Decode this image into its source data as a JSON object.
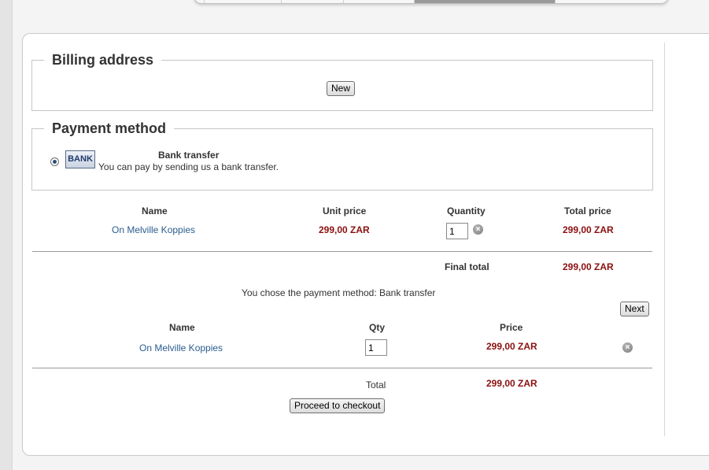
{
  "billing": {
    "legend": "Billing address",
    "new_label": "New"
  },
  "payment": {
    "legend": "Payment method",
    "method_name": "Bank transfer",
    "method_desc": "You can pay by sending us a bank transfer.",
    "logo_text": "BANK",
    "selected": true
  },
  "order_table": {
    "headers": [
      "Name",
      "Unit price",
      "Quantity",
      "Total price"
    ],
    "rows": [
      {
        "name": "On Melville Koppies",
        "unit_price": "299,00 ZAR",
        "quantity": "1",
        "total_price": "299,00 ZAR"
      }
    ],
    "final_total_label": "Final total",
    "final_total_value": "299,00 ZAR"
  },
  "chosen_message": "You chose the payment method: Bank transfer",
  "next_label": "Next",
  "cart_table": {
    "headers": [
      "Name",
      "Qty",
      "Price"
    ],
    "rows": [
      {
        "name": "On Melville Koppies",
        "qty": "1",
        "price": "299,00 ZAR"
      }
    ],
    "total_label": "Total",
    "total_value": "299,00 ZAR"
  },
  "checkout_label": "Proceed to checkout",
  "icons": {
    "remove": "remove-icon",
    "bank": "bank-logo-icon"
  },
  "colors": {
    "price": "#8b1010",
    "link": "#2a5d8f",
    "tab_active": "#9a9a9a"
  }
}
